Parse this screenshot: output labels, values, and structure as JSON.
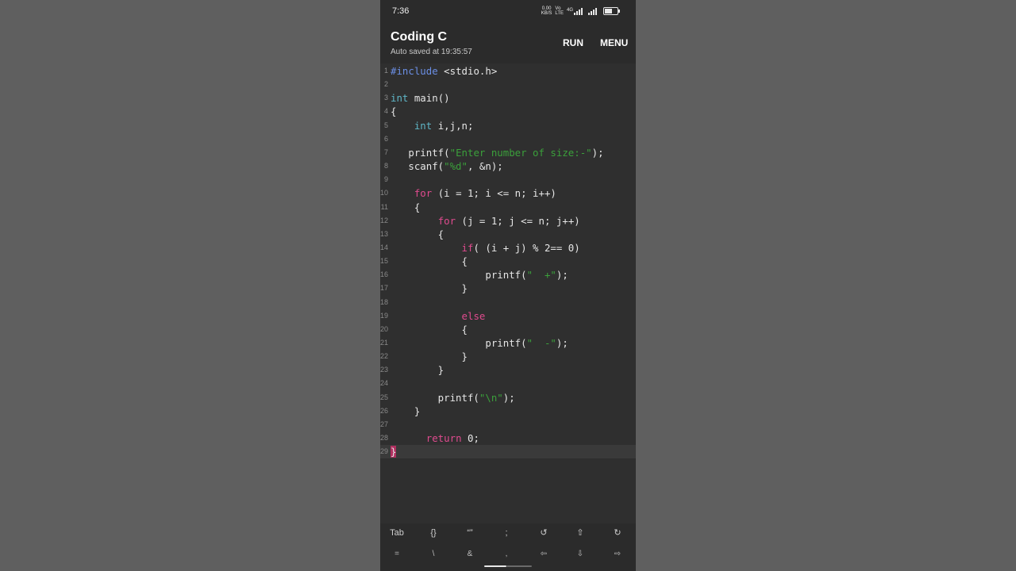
{
  "status_bar": {
    "time": "7:36",
    "net_speed_value": "0.00",
    "net_speed_unit": "KB/S",
    "volte_tag_top": "Vo",
    "volte_tag_bottom": "LTE",
    "network_tag": "4G",
    "icons": [
      "signal-icon",
      "signal-icon",
      "battery-icon"
    ],
    "battery_level": 0.6
  },
  "app_bar": {
    "title": "Coding C",
    "subtitle": "Auto saved at 19:35:57",
    "run_label": "RUN",
    "menu_label": "MENU"
  },
  "editor": {
    "lines": [
      {
        "n": "1",
        "tokens": [
          {
            "t": "#include",
            "k": "pre"
          },
          {
            "t": " <stdio.h>",
            "k": "plain"
          }
        ]
      },
      {
        "n": "2",
        "tokens": []
      },
      {
        "n": "3",
        "tokens": [
          {
            "t": "int",
            "k": "type"
          },
          {
            "t": " main()",
            "k": "plain"
          }
        ]
      },
      {
        "n": "4",
        "tokens": [
          {
            "t": "{",
            "k": "plain"
          }
        ]
      },
      {
        "n": "5",
        "tokens": [
          {
            "t": "    ",
            "k": "plain"
          },
          {
            "t": "int",
            "k": "type"
          },
          {
            "t": " i,j,n;",
            "k": "plain"
          }
        ]
      },
      {
        "n": "6",
        "tokens": []
      },
      {
        "n": "7",
        "tokens": [
          {
            "t": "   printf(",
            "k": "plain"
          },
          {
            "t": "\"Enter number of size:-\"",
            "k": "str"
          },
          {
            "t": ");",
            "k": "plain"
          }
        ]
      },
      {
        "n": "8",
        "tokens": [
          {
            "t": "   scanf(",
            "k": "plain"
          },
          {
            "t": "\"%d\"",
            "k": "str"
          },
          {
            "t": ", &n);",
            "k": "plain"
          }
        ]
      },
      {
        "n": "9",
        "tokens": []
      },
      {
        "n": "10",
        "tokens": [
          {
            "t": "    ",
            "k": "plain"
          },
          {
            "t": "for",
            "k": "kw"
          },
          {
            "t": " (i = 1; i <= n; i++)",
            "k": "plain"
          }
        ]
      },
      {
        "n": "11",
        "tokens": [
          {
            "t": "    {",
            "k": "plain"
          }
        ]
      },
      {
        "n": "12",
        "tokens": [
          {
            "t": "        ",
            "k": "plain"
          },
          {
            "t": "for",
            "k": "kw"
          },
          {
            "t": " (j = 1; j <= n; j++)",
            "k": "plain"
          }
        ]
      },
      {
        "n": "13",
        "tokens": [
          {
            "t": "        {",
            "k": "plain"
          }
        ]
      },
      {
        "n": "14",
        "tokens": [
          {
            "t": "            ",
            "k": "plain"
          },
          {
            "t": "if",
            "k": "kw"
          },
          {
            "t": "( (i + j) % 2== 0)",
            "k": "plain"
          }
        ]
      },
      {
        "n": "15",
        "tokens": [
          {
            "t": "            {",
            "k": "plain"
          }
        ]
      },
      {
        "n": "16",
        "tokens": [
          {
            "t": "                printf(",
            "k": "plain"
          },
          {
            "t": "\"  +\"",
            "k": "str"
          },
          {
            "t": ");",
            "k": "plain"
          }
        ]
      },
      {
        "n": "17",
        "tokens": [
          {
            "t": "            }",
            "k": "plain"
          }
        ]
      },
      {
        "n": "18",
        "tokens": []
      },
      {
        "n": "19",
        "tokens": [
          {
            "t": "            ",
            "k": "plain"
          },
          {
            "t": "else",
            "k": "kw"
          }
        ]
      },
      {
        "n": "20",
        "tokens": [
          {
            "t": "            {",
            "k": "plain"
          }
        ]
      },
      {
        "n": "21",
        "tokens": [
          {
            "t": "                printf(",
            "k": "plain"
          },
          {
            "t": "\"  -\"",
            "k": "str"
          },
          {
            "t": ");",
            "k": "plain"
          }
        ]
      },
      {
        "n": "22",
        "tokens": [
          {
            "t": "            }",
            "k": "plain"
          }
        ]
      },
      {
        "n": "23",
        "tokens": [
          {
            "t": "        }",
            "k": "plain"
          }
        ]
      },
      {
        "n": "24",
        "tokens": []
      },
      {
        "n": "25",
        "tokens": [
          {
            "t": "        printf(",
            "k": "plain"
          },
          {
            "t": "\"\\n\"",
            "k": "str"
          },
          {
            "t": ");",
            "k": "plain"
          }
        ]
      },
      {
        "n": "26",
        "tokens": [
          {
            "t": "    }",
            "k": "plain"
          }
        ]
      },
      {
        "n": "27",
        "tokens": []
      },
      {
        "n": "28",
        "tokens": [
          {
            "t": "      ",
            "k": "plain"
          },
          {
            "t": "return",
            "k": "kw"
          },
          {
            "t": " 0;",
            "k": "plain"
          }
        ]
      },
      {
        "n": "29",
        "tokens": [
          {
            "t": "}",
            "k": "brace-hl"
          }
        ]
      }
    ],
    "active_line": "29"
  },
  "keybar": {
    "row1": [
      {
        "label": "Tab",
        "name": "tab-key"
      },
      {
        "label": "{}",
        "name": "braces-key"
      },
      {
        "label": "“”",
        "name": "quotes-key"
      },
      {
        "label": ";",
        "name": "semicolon-key"
      },
      {
        "label": "↺",
        "name": "undo-icon"
      },
      {
        "label": "⇧",
        "name": "arrow-up-icon"
      },
      {
        "label": "↻",
        "name": "redo-icon"
      }
    ],
    "row2": [
      {
        "label": "=",
        "name": "equals-key"
      },
      {
        "label": "\\",
        "name": "backslash-key"
      },
      {
        "label": "&",
        "name": "ampersand-key"
      },
      {
        "label": ",",
        "name": "comma-key"
      },
      {
        "label": "⇦",
        "name": "arrow-left-icon"
      },
      {
        "label": "⇩",
        "name": "arrow-down-icon"
      },
      {
        "label": "⇨",
        "name": "arrow-right-icon"
      }
    ]
  },
  "colors": {
    "keyword": "#e04b8f",
    "type": "#5fb6c7",
    "preprocessor": "#6b8fe6",
    "string": "#3ba03b",
    "background": "#2f2f2f"
  }
}
